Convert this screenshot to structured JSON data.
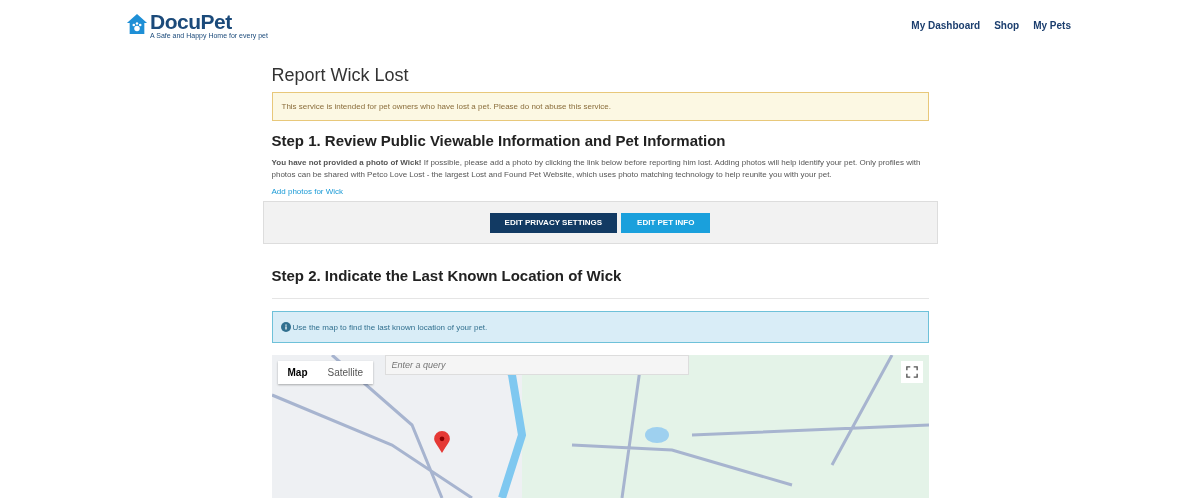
{
  "header": {
    "logo": {
      "name": "DocuPet",
      "tagline": "A Safe and Happy Home for every pet"
    },
    "nav": [
      {
        "label": "My Dashboard"
      },
      {
        "label": "Shop"
      },
      {
        "label": "My Pets"
      }
    ]
  },
  "page": {
    "title": "Report Wick Lost",
    "warning": "This service is intended for pet owners who have lost a pet. Please do not abuse this service.",
    "step1": {
      "heading": "Step 1. Review Public Viewable Information and Pet Information",
      "text": "**You have not provided a photo of Wick!** If possible, please add a photo by clicking the link below before reporting him lost. Adding photos will help identify your pet. Only profiles with photos can be shared with Petco Love Lost - the largest Lost and Found Pet Website, which uses photo matching technology to help reunite you with your pet.",
      "link": "Add photos for Wick",
      "buttons": [
        {
          "label": "EDIT PRIVACY SETTINGS",
          "kind": "dark"
        },
        {
          "label": "EDIT PET INFO",
          "kind": "light"
        }
      ]
    },
    "step2": {
      "heading": "Step 2. Indicate the Last Known Location of Wick",
      "info": "Use the map to find the last known location of your pet.",
      "map": {
        "tabs": [
          {
            "label": "Map",
            "selected": true
          },
          {
            "label": "Satellite",
            "selected": false
          }
        ],
        "search": {
          "placeholder": "Enter a query"
        }
      }
    }
  }
}
